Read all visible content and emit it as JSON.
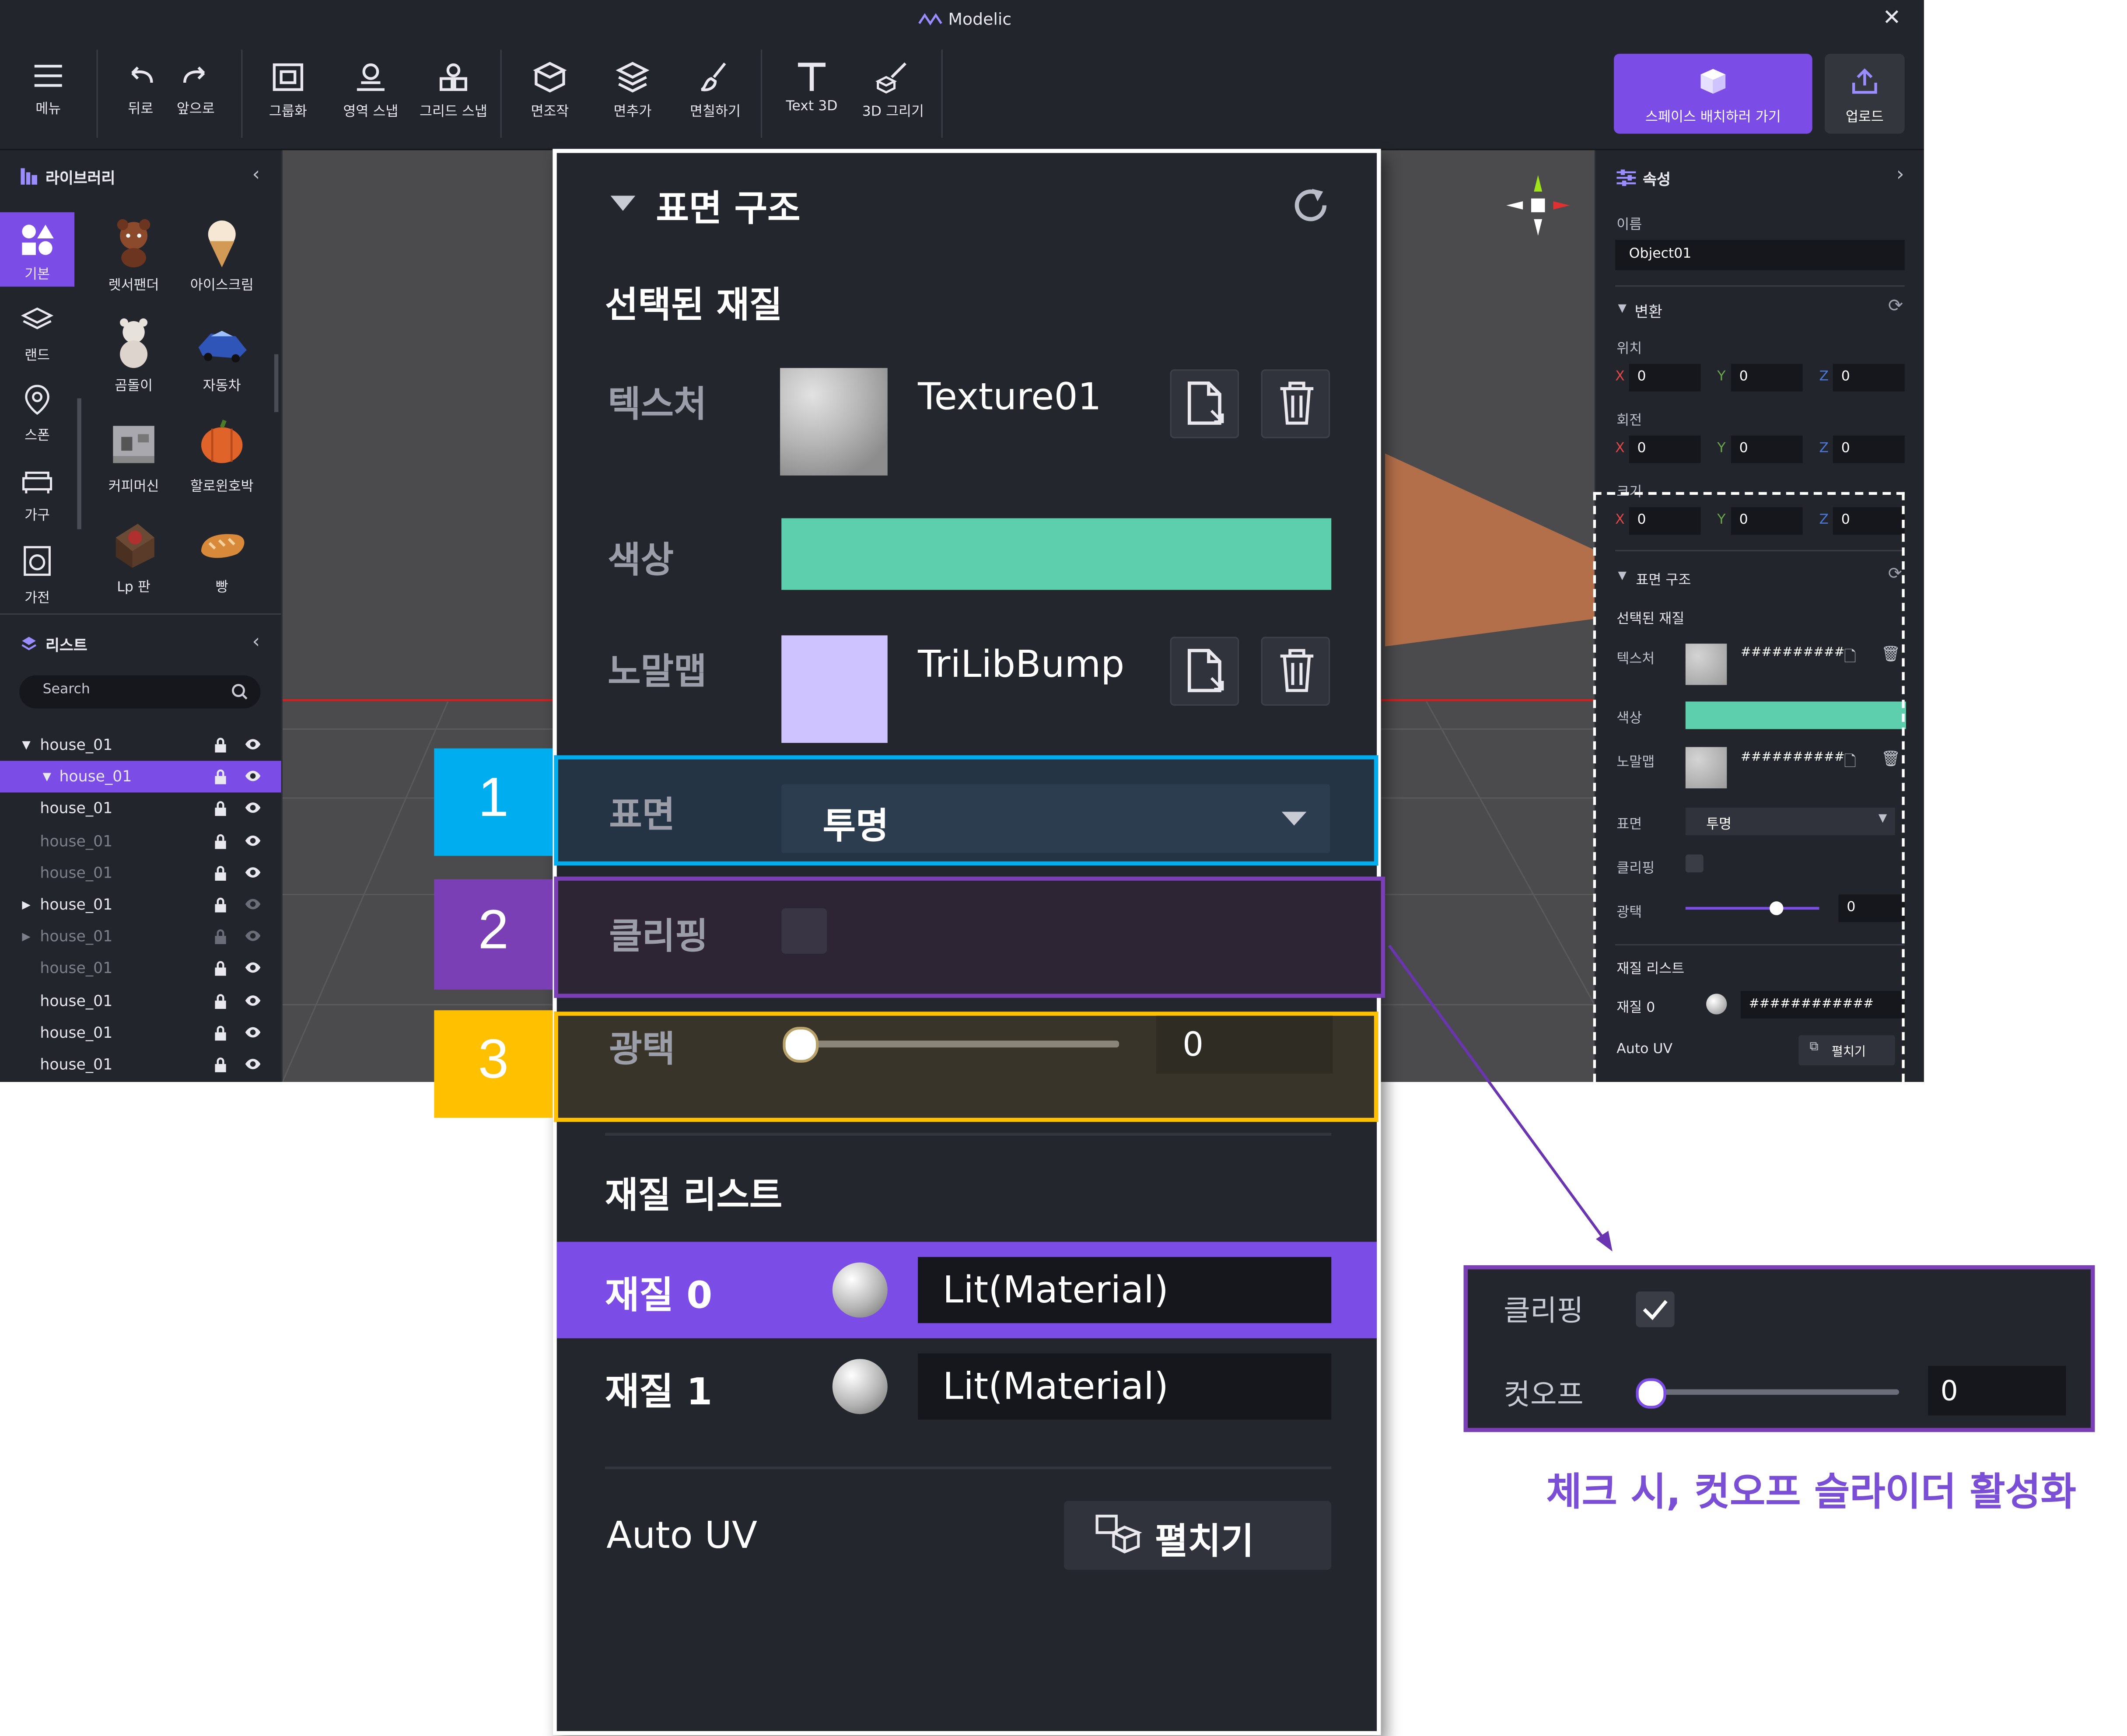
{
  "app": {
    "title": "Modelic"
  },
  "toolbar": {
    "menu": "메뉴",
    "back": "뒤로",
    "forward": "앞으로",
    "group": "그룹화",
    "area_snap": "영역 스냅",
    "grid_snap": "그리드 스냅",
    "face_make": "면조작",
    "face_add": "면추가",
    "face_paint": "면칠하기",
    "text3d": "Text 3D",
    "draw3d": "3D 그리기",
    "space_button": "스페이스 배치하러 가기",
    "upload": "업로드"
  },
  "library": {
    "title": "라이브러리",
    "categories": [
      "기본",
      "랜드",
      "스폰",
      "가구",
      "가전"
    ],
    "items": [
      "렛서팬더",
      "아이스크림",
      "곰돌이",
      "자동차",
      "커피머신",
      "할로윈호박",
      "Lp 판",
      "빵"
    ]
  },
  "list": {
    "title": "리스트",
    "search_placeholder": "Search",
    "rows": [
      "house_01",
      "house_01",
      "house_01",
      "house_01",
      "house_01",
      "house_01",
      "house_01",
      "house_01",
      "house_01",
      "house_01",
      "house_01"
    ]
  },
  "properties": {
    "title": "속성",
    "name_label": "이름",
    "name_value": "Object01",
    "transform_title": "변환",
    "position": "위치",
    "rotation": "회전",
    "scale": "크기",
    "x": "X",
    "y": "Y",
    "z": "Z",
    "zero": "0",
    "surface_title": "표면 구조",
    "selected_material": "선택된 재질",
    "texture": "텍스처",
    "color": "색상",
    "normal": "노말맵",
    "hash": "##########",
    "hash2": "############",
    "surface": "표면",
    "surface_value": "투명",
    "clipping": "클리핑",
    "gloss": "광택",
    "gloss_value": "0",
    "material_list": "재질 리스트",
    "material0": "재질 0",
    "auto_uv": "Auto UV",
    "unfold": "펼치기",
    "color_hex": "#5ecfac"
  },
  "panel": {
    "title": "표면 구조",
    "selected_material": "선택된 재질",
    "texture_label": "텍스처",
    "texture_name": "Texture01",
    "color_label": "색상",
    "color_hex": "#5ecfac",
    "normal_label": "노말맵",
    "normal_name": "TriLibBump",
    "surface_label": "표면",
    "surface_value": "투명",
    "clipping_label": "클리핑",
    "gloss_label": "광택",
    "gloss_value": "0",
    "gloss_level": 0,
    "material_list_title": "재질 리스트",
    "materials": [
      {
        "label": "재질 0",
        "value": "Lit(Material)"
      },
      {
        "label": "재질 1",
        "value": "Lit(Material)"
      }
    ],
    "auto_uv_label": "Auto UV",
    "unfold_label": "펼치기"
  },
  "callouts": [
    {
      "number": "1",
      "color": "#00aeef"
    },
    {
      "number": "2",
      "color": "#7a3fb5"
    },
    {
      "number": "3",
      "color": "#ffc000"
    }
  ],
  "detail": {
    "clipping_label": "클리핑",
    "cutoff_label": "컷오프",
    "cutoff_value": "0",
    "cutoff_level": 0,
    "caption": "체크 시, 컷오프 슬라이더 활성화"
  }
}
